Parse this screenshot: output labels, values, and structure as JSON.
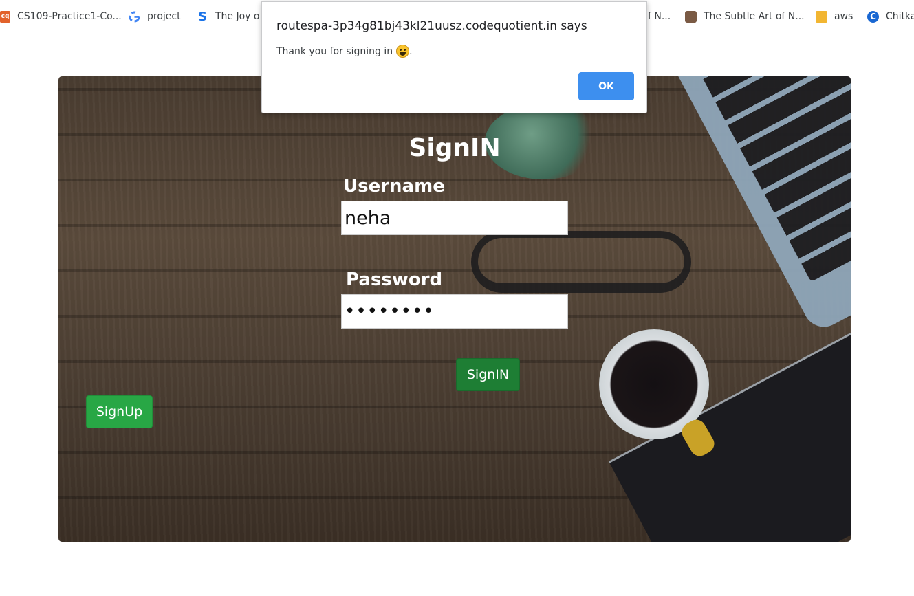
{
  "bookmarks": [
    {
      "label": "CS109-Practice1-Co...",
      "icon": "codequotient-icon"
    },
    {
      "label": "project",
      "icon": "google-icon"
    },
    {
      "label": "The Joy of",
      "icon": "s-logo-icon"
    },
    {
      "label": "f N...",
      "icon": ""
    },
    {
      "label": "The Subtle Art of N...",
      "icon": "cat-avatar-icon"
    },
    {
      "label": "aws",
      "icon": "box-icon"
    },
    {
      "label": "Chitka",
      "icon": "c-logo-icon"
    }
  ],
  "form": {
    "title": "SignIN",
    "username_label": "Username",
    "username_value": "neha",
    "password_label": "Password",
    "password_value": "••••••••",
    "signin_label": "SignIN",
    "signup_label": "SignUp"
  },
  "dialog": {
    "title": "routespa-3p34g81bj43kl21uusz.codequotient.in says",
    "message": "Thank you for signing in",
    "message_suffix": ".",
    "emoji": "grinning-face-emoji",
    "ok_label": "OK"
  },
  "colors": {
    "signin_button": "#1e7e34",
    "signup_button": "#28a745",
    "dialog_ok": "#3d8fef"
  }
}
